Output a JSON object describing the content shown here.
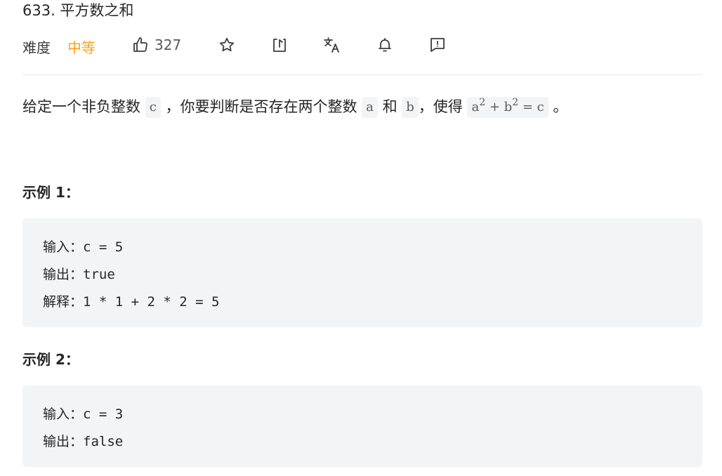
{
  "problem": {
    "title": "633. 平方数之和",
    "difficulty_label": "难度",
    "difficulty": "中等",
    "likes": "327",
    "icons": [
      "thumbs-up-icon",
      "star-icon",
      "share-icon",
      "translate-icon",
      "bell-icon",
      "feedback-icon"
    ]
  },
  "description": {
    "p1": "给定一个非负整数",
    "c": "c",
    "p2": "，你要判断是否存在两个整数",
    "a": "a",
    "p3": "和",
    "b": "b",
    "p4": "，使得",
    "eq_a": "a",
    "eq_exp1": "2",
    "eq_plus": " + b",
    "eq_exp2": "2",
    "eq_rest": " = c",
    "p5": "。"
  },
  "examples": [
    {
      "heading": "示例 1：",
      "lines": [
        "输入：c = 5",
        "输出：true",
        "解释：1 * 1 + 2 * 2 = 5"
      ]
    },
    {
      "heading": "示例 2：",
      "lines": [
        "输入：c = 3",
        "输出：false"
      ]
    }
  ],
  "colors": {
    "accent": "#ffa116",
    "code_bg": "#f3f4f5",
    "text": "#262626"
  }
}
